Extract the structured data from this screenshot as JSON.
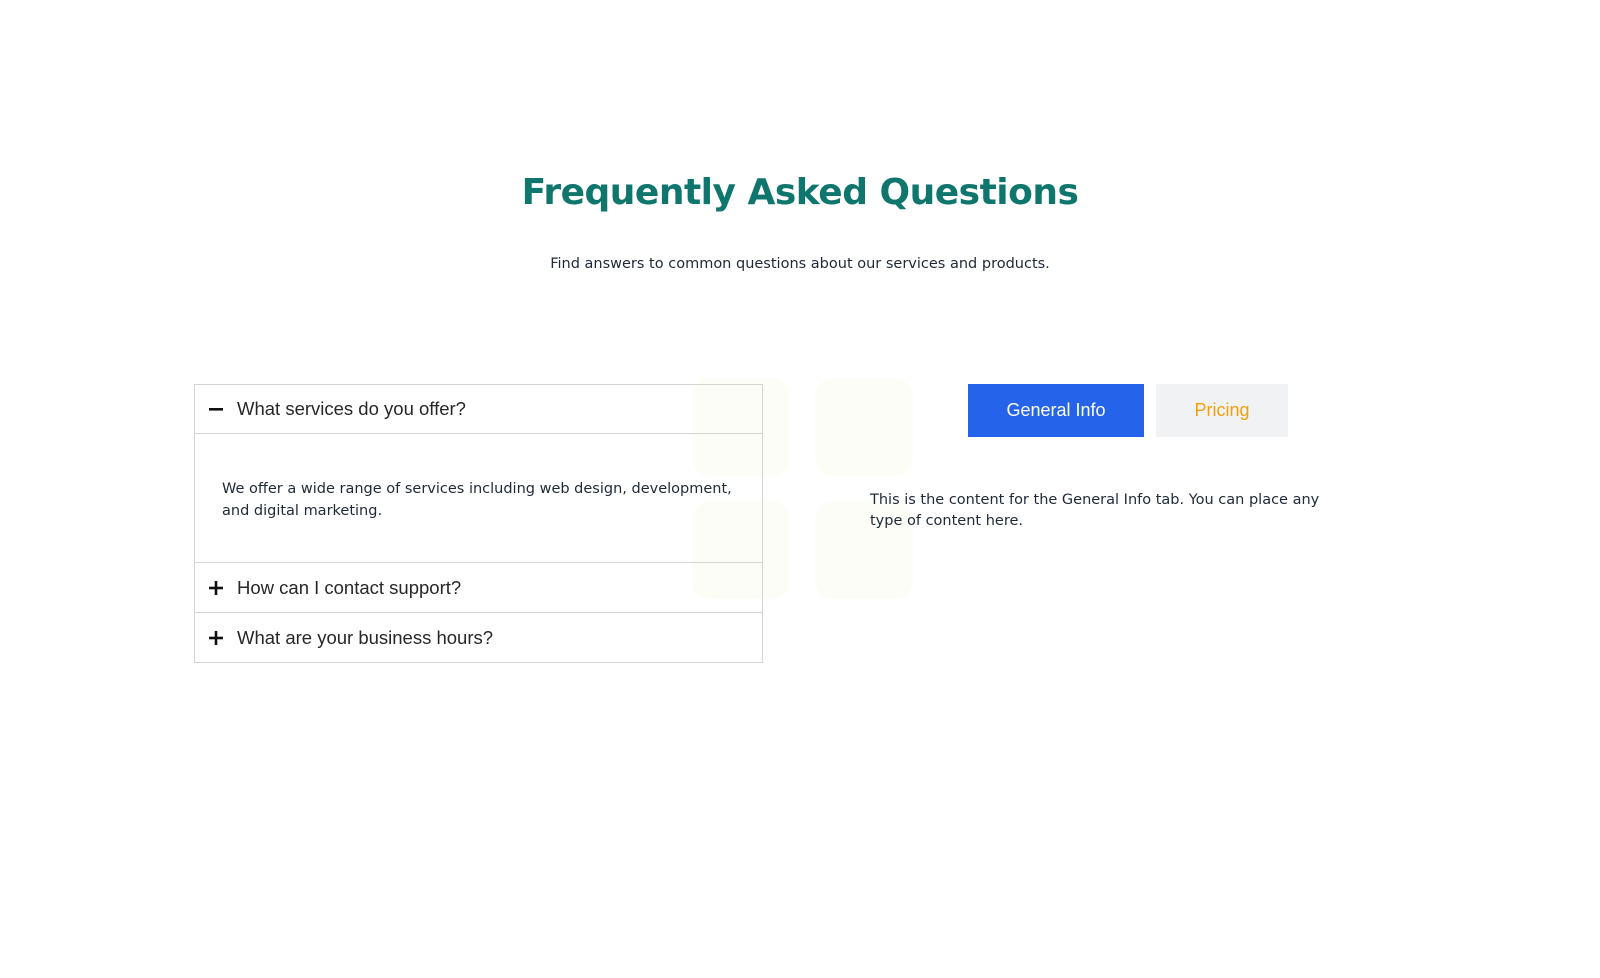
{
  "header": {
    "title": "Frequently Asked Questions",
    "subtitle": "Find answers to common questions about our services and products."
  },
  "accordion": {
    "items": [
      {
        "question": "What services do you offer?",
        "answer": "We offer a wide range of services including web design, development, and digital marketing.",
        "expanded": true,
        "icon": "minus-icon"
      },
      {
        "question": "How can I contact support?",
        "expanded": false,
        "icon": "plus-icon"
      },
      {
        "question": "What are your business hours?",
        "expanded": false,
        "icon": "plus-icon"
      }
    ]
  },
  "tabs": {
    "items": [
      {
        "label": "General Info",
        "active": true
      },
      {
        "label": "Pricing",
        "active": false
      }
    ],
    "active_content": "This is the content for the General Info tab. You can place any type of content here."
  },
  "colors": {
    "title": "#0f766e",
    "tab_active_bg": "#2563eb",
    "tab_active_text": "#ffffff",
    "tab_inactive_bg": "#f1f2f4",
    "tab_inactive_text": "#f59e0b",
    "border": "#d4d4d4"
  }
}
